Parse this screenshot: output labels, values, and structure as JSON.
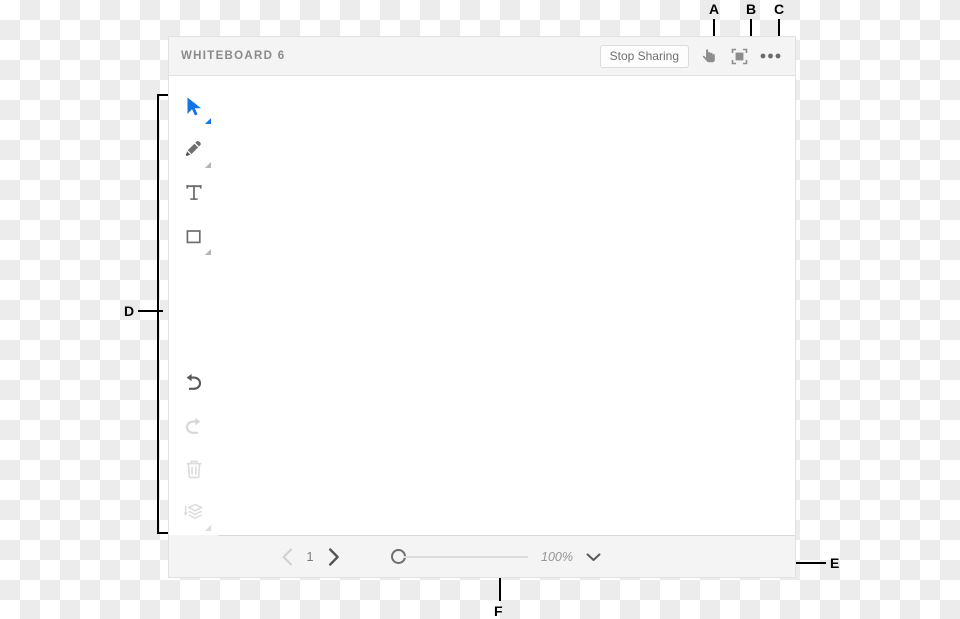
{
  "window": {
    "title": "WHITEBOARD 6"
  },
  "header": {
    "stop_sharing_label": "Stop Sharing",
    "icons": [
      {
        "name": "pointer-hand-icon",
        "label": "Pointer"
      },
      {
        "name": "fit-to-screen-icon",
        "label": "Fit to screen"
      },
      {
        "name": "more-options-icon",
        "label": "More options"
      }
    ]
  },
  "toolbar": {
    "tools": [
      {
        "name": "select-tool",
        "label": "Select",
        "active": true,
        "has_flyout": true
      },
      {
        "name": "pencil-tool",
        "label": "Pencil",
        "active": false,
        "has_flyout": true
      },
      {
        "name": "text-tool",
        "label": "Text",
        "active": false,
        "has_flyout": false
      },
      {
        "name": "shape-tool",
        "label": "Shape",
        "active": false,
        "has_flyout": true
      },
      {
        "name": "undo-tool",
        "label": "Undo",
        "active": false,
        "has_flyout": false
      },
      {
        "name": "redo-tool",
        "label": "Redo",
        "active": false,
        "has_flyout": false
      },
      {
        "name": "delete-tool",
        "label": "Delete",
        "active": false,
        "has_flyout": false
      },
      {
        "name": "layers-tool",
        "label": "Layers",
        "active": false,
        "has_flyout": true
      }
    ]
  },
  "footer": {
    "page_number": "1",
    "prev_page_label": "Previous page",
    "next_page_label": "Next page",
    "zoom_value": "100%",
    "zoom_percent": 0,
    "zoom_dropdown_label": "Zoom options"
  },
  "callouts": [
    {
      "id": "A",
      "label": "A"
    },
    {
      "id": "B",
      "label": "B"
    },
    {
      "id": "C",
      "label": "C"
    },
    {
      "id": "D",
      "label": "D"
    },
    {
      "id": "E",
      "label": "E"
    },
    {
      "id": "F",
      "label": "F"
    }
  ],
  "colors": {
    "accent_blue": "#1473e6",
    "panel_bg": "#f4f4f4",
    "canvas_bg": "#ffffff",
    "text_gray": "#8a8a8a",
    "icon_gray": "#8d8d8d",
    "icon_disabled": "#d6d6d6",
    "checker_gray": "#ececec"
  }
}
